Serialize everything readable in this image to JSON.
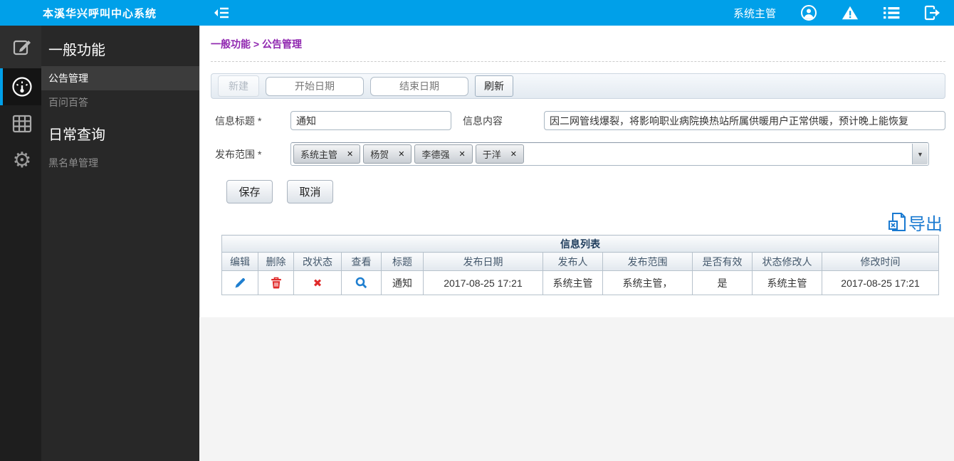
{
  "app": {
    "title": "本溪华兴呼叫中心系统"
  },
  "topbar": {
    "user_label": "系统主管"
  },
  "icons": {
    "remove": "✕",
    "dropdown": "▼",
    "toggle": "✖",
    "gear": "⚙"
  },
  "sidebar": {
    "groups": [
      {
        "header": "一般功能",
        "items": [
          {
            "label": "公告管理"
          },
          {
            "label": "百问百答"
          }
        ]
      },
      {
        "header": "日常查询",
        "items": [
          {
            "label": "黑名单管理"
          }
        ]
      }
    ]
  },
  "breadcrumb": {
    "path": "一般功能 > 公告管理"
  },
  "toolbar": {
    "new_label": "新建",
    "start_placeholder": "开始日期",
    "end_placeholder": "结束日期",
    "refresh_label": "刷新"
  },
  "form": {
    "title_label": "信息标题",
    "required": "*",
    "title_value": "通知",
    "content_label": "信息内容",
    "content_value": "因二网管线爆裂，将影响职业病院换热站所属供暖用户正常供暖，预计晚上能恢复",
    "scope_label": "发布范围",
    "scope_tags": [
      {
        "label": "系统主管"
      },
      {
        "label": "杨贺"
      },
      {
        "label": "李德强"
      },
      {
        "label": "于洋"
      }
    ],
    "save_label": "保存",
    "cancel_label": "取消"
  },
  "export_label": "导出",
  "table": {
    "title": "信息列表",
    "columns": [
      "编辑",
      "删除",
      "改状态",
      "查看",
      "标题",
      "发布日期",
      "发布人",
      "发布范围",
      "是否有效",
      "状态修改人",
      "修改时间"
    ],
    "rows": [
      {
        "title": "通知",
        "publish_date": "2017-08-25 17:21",
        "publisher": "系统主管",
        "scope": "系统主管，",
        "valid": "是",
        "modifier": "系统主管",
        "modified": "2017-08-25 17:21"
      }
    ]
  },
  "colors": {
    "accent_blue": "#00a0e9",
    "link_blue": "#1a7ad1",
    "breadcrumb_purple": "#9027b0",
    "danger_red": "#e02b2b"
  }
}
